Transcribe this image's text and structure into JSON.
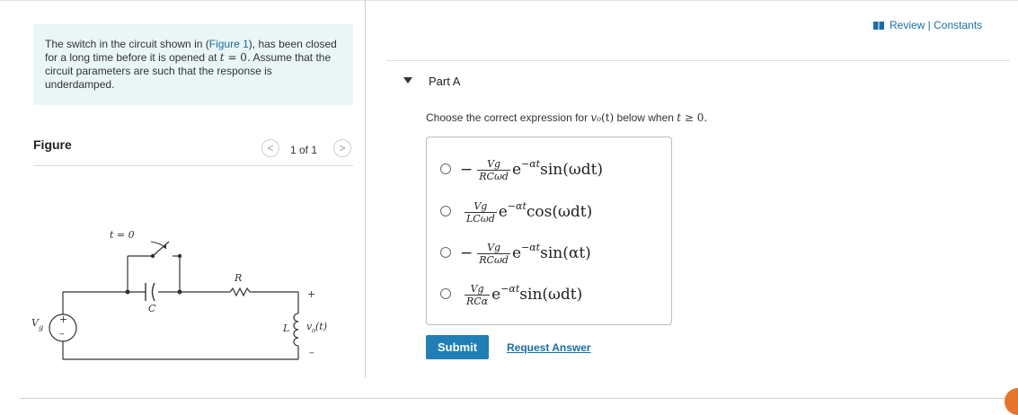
{
  "problem": {
    "pre_link": "The switch in the circuit shown in (",
    "link": "Figure 1",
    "post_link": "), has been closed for a long time before it is opened at ",
    "math_t": "t",
    "math_rest": " = 0.",
    "sentence2": "Assume that the circuit parameters are such that the response is underdamped."
  },
  "figure": {
    "heading": "Figure",
    "pager": "1 of 1",
    "prev_glyph": "<",
    "next_glyph": ">",
    "labels": {
      "switch_time": "t = 0",
      "capacitor": "C",
      "resistor": "R",
      "inductor": "L",
      "source": "V",
      "source_sub": "g",
      "plus": "+",
      "minus": "–",
      "vo": "v",
      "vo_sub": "o",
      "vo_arg": "(t)"
    }
  },
  "header": {
    "review": "Review | Constants"
  },
  "part": {
    "title": "Part A"
  },
  "question": {
    "pre": "Choose the correct expression for ",
    "var": "v",
    "var_sub": "o",
    "arg": "(t)",
    "mid": " below when ",
    "t": "t",
    "cond": " ≥ 0."
  },
  "choices": [
    {
      "sign": "−",
      "num": "Vg",
      "den": "RCωd",
      "exp": "e",
      "sup": "−αt",
      "func": "sin(ωdt)"
    },
    {
      "sign": "",
      "num": "Vg",
      "den": "LCωd",
      "exp": "e",
      "sup": "−αt",
      "func": "cos(ωdt)"
    },
    {
      "sign": "−",
      "num": "Vg",
      "den": "RCωd",
      "exp": "e",
      "sup": "−αt",
      "func": "sin(αt)"
    },
    {
      "sign": "",
      "num": "Vg",
      "den": "RCα",
      "exp": "e",
      "sup": "−αt",
      "func": "sin(ωdt)"
    }
  ],
  "actions": {
    "submit": "Submit",
    "request": "Request Answer"
  },
  "colors": {
    "accent": "#1f7fb6",
    "link": "#1a6ea8",
    "panel": "#e9f6f5"
  }
}
